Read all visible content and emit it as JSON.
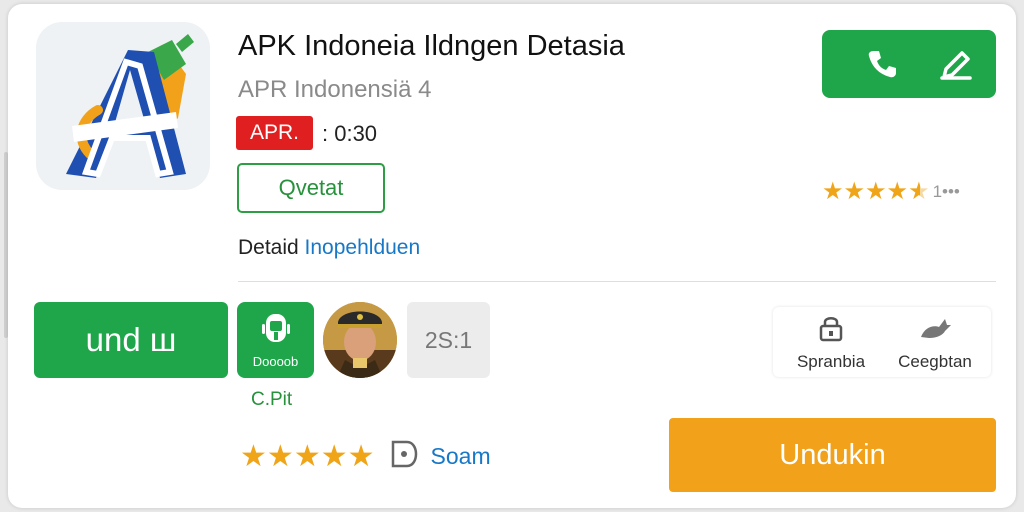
{
  "app": {
    "title": "APK Indoneia Ildngen Detasia",
    "subtitle": "APR Indonensiä 4",
    "badge": "APR.",
    "time": ": 0:30",
    "outline_button": "Qvetat",
    "detail_label": "Detaid",
    "detail_link": "Inopehlduen"
  },
  "rating": {
    "top_stars": 4.5,
    "top_count": "1•••",
    "bottom_stars": 5
  },
  "actions": {
    "download_left": "und ш",
    "android_tile_label": "Doooob",
    "android_caption": "C.Pit",
    "count_tile": "2S:1",
    "side_item_1": "Spranbia",
    "side_item_2": "Ceegbtan",
    "save_label": "Soam",
    "download_main": "Undukin"
  },
  "colors": {
    "green": "#1fa64a",
    "orange": "#f2a21a",
    "red": "#e02020",
    "link": "#1878c8",
    "star": "#f0a418"
  },
  "icons": [
    "app-logo-icon",
    "phone-icon",
    "edit-icon",
    "android-icon",
    "lock-icon",
    "bird-icon",
    "info-tag-icon"
  ]
}
